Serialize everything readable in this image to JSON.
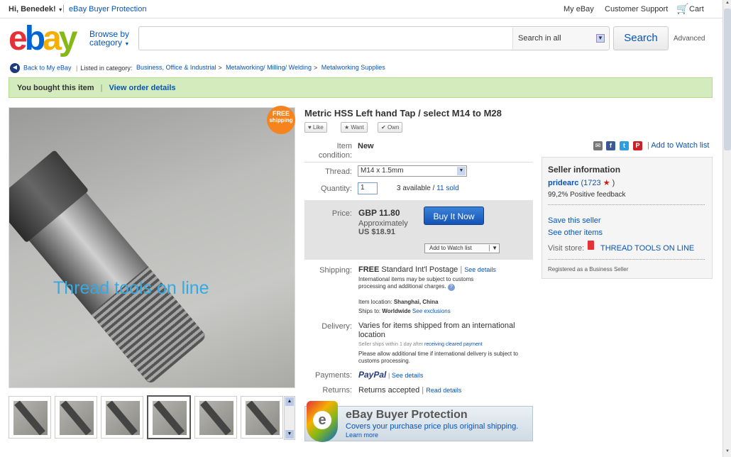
{
  "topbar": {
    "greeting": "Hi, Benedek!",
    "buyer_protection": "eBay Buyer Protection",
    "my_ebay": "My eBay",
    "support": "Customer Support",
    "cart": "Cart"
  },
  "header": {
    "browse": "Browse by",
    "category": "category",
    "search_placeholder": "",
    "search_in": "Search in all",
    "search_btn": "Search",
    "advanced": "Advanced"
  },
  "breadcrumb": {
    "back": "Back to My eBay",
    "listed": "Listed in category:",
    "crumbs": [
      "Business, Office & Industrial",
      "Metalworking/ Milling/ Welding",
      "Metalworking Supplies"
    ]
  },
  "order": {
    "bought": "You bought this item",
    "view": "View order details"
  },
  "image": {
    "free1": "FREE",
    "free2": "shipping",
    "watermark": "Thread tools on line"
  },
  "item": {
    "title": "Metric HSS Left hand Tap / select M14 to M28",
    "like": "Like",
    "want": "Want",
    "own": "Own",
    "condition_label": "Item condition:",
    "condition": "New",
    "thread_label": "Thread:",
    "thread": "M14 x 1.5mm",
    "qty_label": "Quantity:",
    "qty": "1",
    "available": "3 available /",
    "sold": "11 sold",
    "price_label": "Price:",
    "price": "GBP 11.80",
    "approx": "Approximately",
    "usd": "US $18.91",
    "buy_now": "Buy It Now",
    "watch_btn": "Add to Watch list",
    "shipping_label": "Shipping:",
    "free": "FREE",
    "ship_method": "Standard Int'l Postage",
    "see_details": "See details",
    "intl_note": "International items may be subject to customs processing and additional charges.",
    "location_label": "Item location:",
    "location": "Shanghai, China",
    "ships_to_label": "Ships to:",
    "ships_to": "Worldwide",
    "exclusions": "See exclusions",
    "delivery_label": "Delivery:",
    "delivery": "Varies for items shipped from an international location",
    "seller_ships": "Seller ships within 1 day after",
    "receiving": "receiving cleared payment",
    "allow": "Please allow additional time if international delivery is subject to customs processing.",
    "payments_label": "Payments:",
    "paypal": "PayPal",
    "pay_details": "See details",
    "returns_label": "Returns:",
    "returns": "Returns accepted",
    "read_details": "Read details",
    "bp_title": "eBay Buyer Protection",
    "bp_sub": "Covers your purchase price plus original shipping.",
    "bp_more": "Learn more"
  },
  "share": {
    "watch": "Add to Watch list"
  },
  "seller": {
    "heading": "Seller information",
    "name": "pridearc",
    "score_open": "(1723",
    "score_close": ")",
    "feedback": "99,2% Positive feedback",
    "save": "Save this seller",
    "other": "See other items",
    "visit": "Visit store:",
    "store": "THREAD TOOLS ON LINE",
    "registered": "Registered as a Business Seller"
  }
}
